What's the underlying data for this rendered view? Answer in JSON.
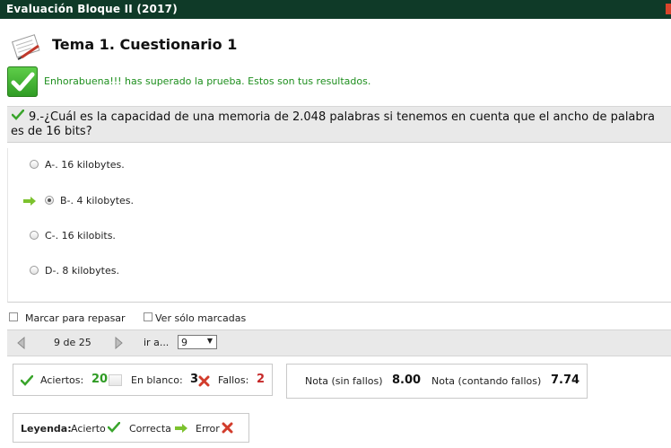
{
  "window": {
    "title": "Evaluación Bloque II (2017)"
  },
  "header": {
    "title": "Tema 1. Cuestionario 1",
    "icon": "paper-pencil-icon"
  },
  "result": {
    "message": "Enhorabuena!!! has superado la prueba. Estos son tus resultados.",
    "icon": "big-check-icon"
  },
  "question": {
    "text": "9.-¿Cuál es la capacidad de una memoria de 2.048 palabras si tenemos en cuenta que el ancho de palabra es de 16 bits?"
  },
  "answers": [
    {
      "label": "A-. 16 kilobytes.",
      "selected": false,
      "correct": false
    },
    {
      "label": "B-. 4 kilobytes.",
      "selected": true,
      "correct": false
    },
    {
      "label": "C-. 16 kilobits.",
      "selected": false,
      "correct": false
    },
    {
      "label": "D-. 8 kilobytes.",
      "selected": false,
      "correct": false
    }
  ],
  "options": {
    "review_label": "Marcar para repasar",
    "show_marked_label": "Ver sólo marcadas"
  },
  "pager": {
    "count": "9 de 25",
    "goto_label": "ir a...",
    "goto_value": "9"
  },
  "stats": {
    "correct_label": "Aciertos:",
    "correct_value": "20",
    "blank_label": "En blanco:",
    "blank_value": "3",
    "wrong_label": "Fallos:",
    "wrong_value": "2"
  },
  "grades": {
    "no_penalty_label": "Nota (sin fallos)",
    "no_penalty_value": "8.00",
    "with_penalty_label": "Nota (contando fallos)",
    "with_penalty_value": "7.74"
  },
  "legend": {
    "title": "Leyenda:",
    "item1": "Acierto",
    "item2": "Correcta",
    "item3": "Error"
  },
  "colors": {
    "titlebar": "#0f3a28",
    "success_text": "#1e8f1e",
    "correct_green": "#2f9b24",
    "error_red": "#d23c2c"
  }
}
